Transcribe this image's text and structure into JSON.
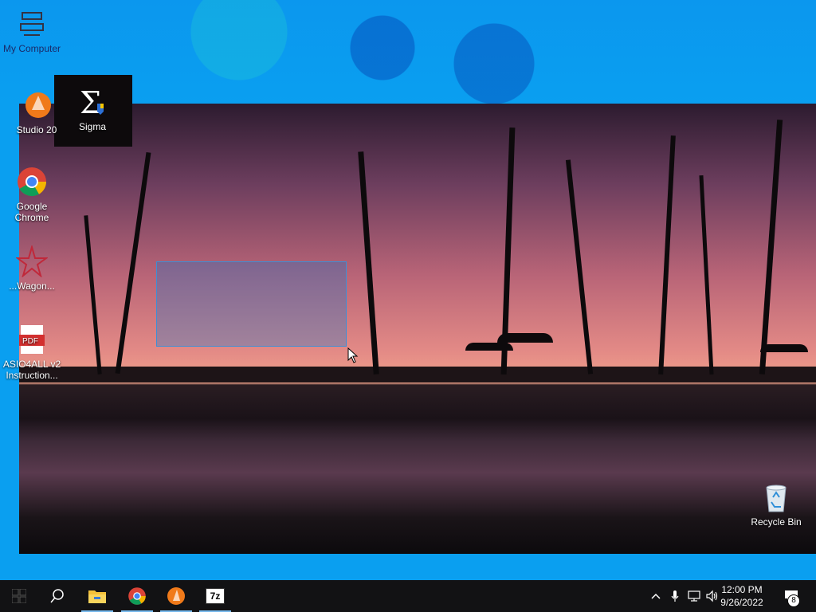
{
  "desktop": {
    "icons": [
      {
        "label": "My Computer"
      },
      {
        "label": "Studio 20"
      },
      {
        "label": "Sigma"
      },
      {
        "label": "Google Chrome"
      },
      {
        "label": "...Wagon..."
      },
      {
        "label": "ASIO4ALL v2 Instruction..."
      },
      {
        "label": "Recycle Bin"
      }
    ]
  },
  "taskbar": {
    "apps": [
      {
        "name": "file-explorer-icon"
      },
      {
        "name": "chrome-icon"
      },
      {
        "name": "fl-studio-icon"
      },
      {
        "name": "7zip-icon",
        "label": "7z"
      }
    ],
    "time": "12:00 PM",
    "date": "9/26/2022",
    "notification_count": "8"
  },
  "colors": {
    "accent": "#0078d7",
    "desktop_bg": "#0a9ff0",
    "taskbar": "#121214"
  }
}
